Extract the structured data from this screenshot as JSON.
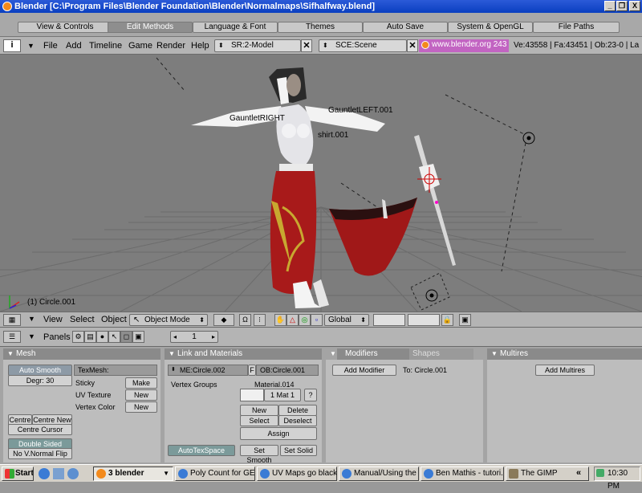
{
  "window": {
    "title": "Blender [C:\\Program Files\\Blender Foundation\\Blender\\Normalmaps\\Sifhalfway.blend]",
    "min": "_",
    "max": "❐",
    "close": "X"
  },
  "prefs_tabs": [
    "View & Controls",
    "Edit Methods",
    "Language & Font",
    "Themes",
    "Auto Save",
    "System & OpenGL",
    "File Paths"
  ],
  "prefs_selected": "Edit Methods",
  "menu": {
    "items": [
      "File",
      "Add",
      "Timeline",
      "Game",
      "Render",
      "Help"
    ],
    "screen": "SR:2-Model",
    "scene": "SCE:Scene",
    "url": "www.blender.org 243",
    "stats": "Ve:43558 | Fa:43451 | Ob:23-0 | La"
  },
  "viewport": {
    "labels": [
      "GauntletLEFT.001",
      "GauntletRIGHT",
      "shirt.001"
    ],
    "selected_object": "(1) Circle.001"
  },
  "view3d_header": {
    "view": "View",
    "select": "Select",
    "object": "Object",
    "mode": "Object Mode",
    "orientation": "Global"
  },
  "buttons_header": {
    "panels_label": "Panels",
    "frame": "1"
  },
  "mesh_panel": {
    "title": "Mesh",
    "auto_smooth": "Auto Smooth",
    "degr": "Degr: 30",
    "texmesh": "TexMesh:",
    "sticky": "Sticky",
    "sticky_btn": "Make",
    "uv_texture": "UV Texture",
    "uv_btn": "New",
    "vertex_color": "Vertex Color",
    "vc_btn": "New",
    "centre": "Centre",
    "centre_new": "Centre New",
    "centre_cursor": "Centre Cursor",
    "double_sided": "Double Sided",
    "no_vnormal_flip": "No V.Normal Flip"
  },
  "link_panel": {
    "title": "Link and Materials",
    "me": "ME:Circle.002",
    "f": "F",
    "ob": "OB:Circle.001",
    "vertex_groups": "Vertex Groups",
    "material": "Material.014",
    "mat_index": "1 Mat 1",
    "mat_q": "?",
    "new": "New",
    "delete": "Delete",
    "select": "Select",
    "deselect": "Deselect",
    "assign": "Assign",
    "autotexspace": "AutoTexSpace",
    "set_smooth": "Set Smooth",
    "set_solid": "Set Solid"
  },
  "modifiers_panel": {
    "tab_modifiers": "Modifiers",
    "tab_shapes": "Shapes",
    "add_modifier": "Add Modifier",
    "to": "To: Circle.001"
  },
  "multires_panel": {
    "title": "Multires",
    "add_multires": "Add Multires"
  },
  "taskbar": {
    "start": "Start",
    "tasks": [
      "3 blender",
      "Poly Count for GE ...",
      "UV Maps go black ...",
      "Manual/Using the ...",
      "Ben Mathis - tutori...",
      "The GIMP"
    ],
    "clock": "10:30 PM",
    "chevron": "«"
  },
  "colors": {
    "title_blue": "#0a3fc0",
    "url_magenta": "#c264c2",
    "viewport": "#7d7d7d",
    "cloth_red": "#a01818"
  }
}
